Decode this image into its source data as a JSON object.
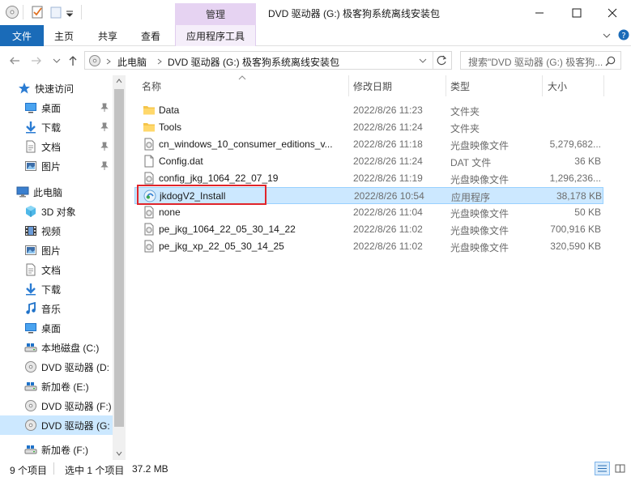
{
  "window": {
    "title": "DVD 驱动器 (G:) 极客狗系统离线安装包",
    "context_tab": "管理",
    "context_tab_color": "#e6d3f2"
  },
  "ribbon": {
    "file": "文件",
    "tabs": [
      "主页",
      "共享",
      "查看"
    ],
    "app_tools": "应用程序工具",
    "file_color": "#1a6bb8"
  },
  "address": {
    "crumbs": [
      "此电脑",
      "DVD 驱动器 (G:) 极客狗系统离线安装包"
    ],
    "search_placeholder": "搜索\"DVD 驱动器 (G:) 极客狗..."
  },
  "nav": {
    "items": [
      {
        "label": "快速访问",
        "icon": "star-icon"
      },
      {
        "label": "桌面",
        "icon": "desktop-icon"
      },
      {
        "label": "下载",
        "icon": "download-icon"
      },
      {
        "label": "文档",
        "icon": "document-icon"
      },
      {
        "label": "图片",
        "icon": "picture-icon"
      },
      {
        "label": "此电脑",
        "icon": "computer-icon"
      },
      {
        "label": "3D 对象",
        "icon": "cube-icon"
      },
      {
        "label": "视频",
        "icon": "video-icon"
      },
      {
        "label": "图片",
        "icon": "picture-icon"
      },
      {
        "label": "文档",
        "icon": "document-icon"
      },
      {
        "label": "下载",
        "icon": "download-icon"
      },
      {
        "label": "音乐",
        "icon": "music-icon"
      },
      {
        "label": "桌面",
        "icon": "desktop-icon"
      },
      {
        "label": "本地磁盘 (C:)",
        "icon": "drive-icon"
      },
      {
        "label": "DVD 驱动器 (D:",
        "icon": "dvd-icon"
      },
      {
        "label": "新加卷 (E:)",
        "icon": "drive-icon"
      },
      {
        "label": "DVD 驱动器 (F:)",
        "icon": "dvd-icon"
      },
      {
        "label": "DVD 驱动器 (G:",
        "icon": "dvd-icon"
      },
      {
        "label": "新加卷 (F:)",
        "icon": "drive-icon"
      }
    ]
  },
  "columns": {
    "name": "名称",
    "date": "修改日期",
    "type": "类型",
    "size": "大小"
  },
  "files": [
    {
      "name": "Data",
      "date": "2022/8/26 11:23",
      "type": "文件夹",
      "size": "",
      "icon": "folder-icon"
    },
    {
      "name": "Tools",
      "date": "2022/8/26 11:24",
      "type": "文件夹",
      "size": "",
      "icon": "folder-icon"
    },
    {
      "name": "cn_windows_10_consumer_editions_v...",
      "date": "2022/8/26 11:18",
      "type": "光盘映像文件",
      "size": "5,279,682...",
      "icon": "disc-image-icon"
    },
    {
      "name": "Config.dat",
      "date": "2022/8/26 11:24",
      "type": "DAT 文件",
      "size": "36 KB",
      "icon": "file-icon"
    },
    {
      "name": "config_jkg_1064_22_07_19",
      "date": "2022/8/26 11:19",
      "type": "光盘映像文件",
      "size": "1,296,236...",
      "icon": "disc-image-icon"
    },
    {
      "name": "jkdogV2_Install",
      "date": "2022/8/26 10:54",
      "type": "应用程序",
      "size": "38,178 KB",
      "icon": "installer-icon"
    },
    {
      "name": "none",
      "date": "2022/8/26 11:04",
      "type": "光盘映像文件",
      "size": "50 KB",
      "icon": "disc-image-icon"
    },
    {
      "name": "pe_jkg_1064_22_05_30_14_22",
      "date": "2022/8/26 11:02",
      "type": "光盘映像文件",
      "size": "700,916 KB",
      "icon": "disc-image-icon"
    },
    {
      "name": "pe_jkg_xp_22_05_30_14_25",
      "date": "2022/8/26 11:02",
      "type": "光盘映像文件",
      "size": "320,590 KB",
      "icon": "disc-image-icon"
    }
  ],
  "status": {
    "count": "9 个项目",
    "selected": "选中 1 个项目",
    "size": "37.2 MB"
  },
  "colors": {
    "selection": "#cce8ff",
    "highlight_box": "#e0242a"
  }
}
